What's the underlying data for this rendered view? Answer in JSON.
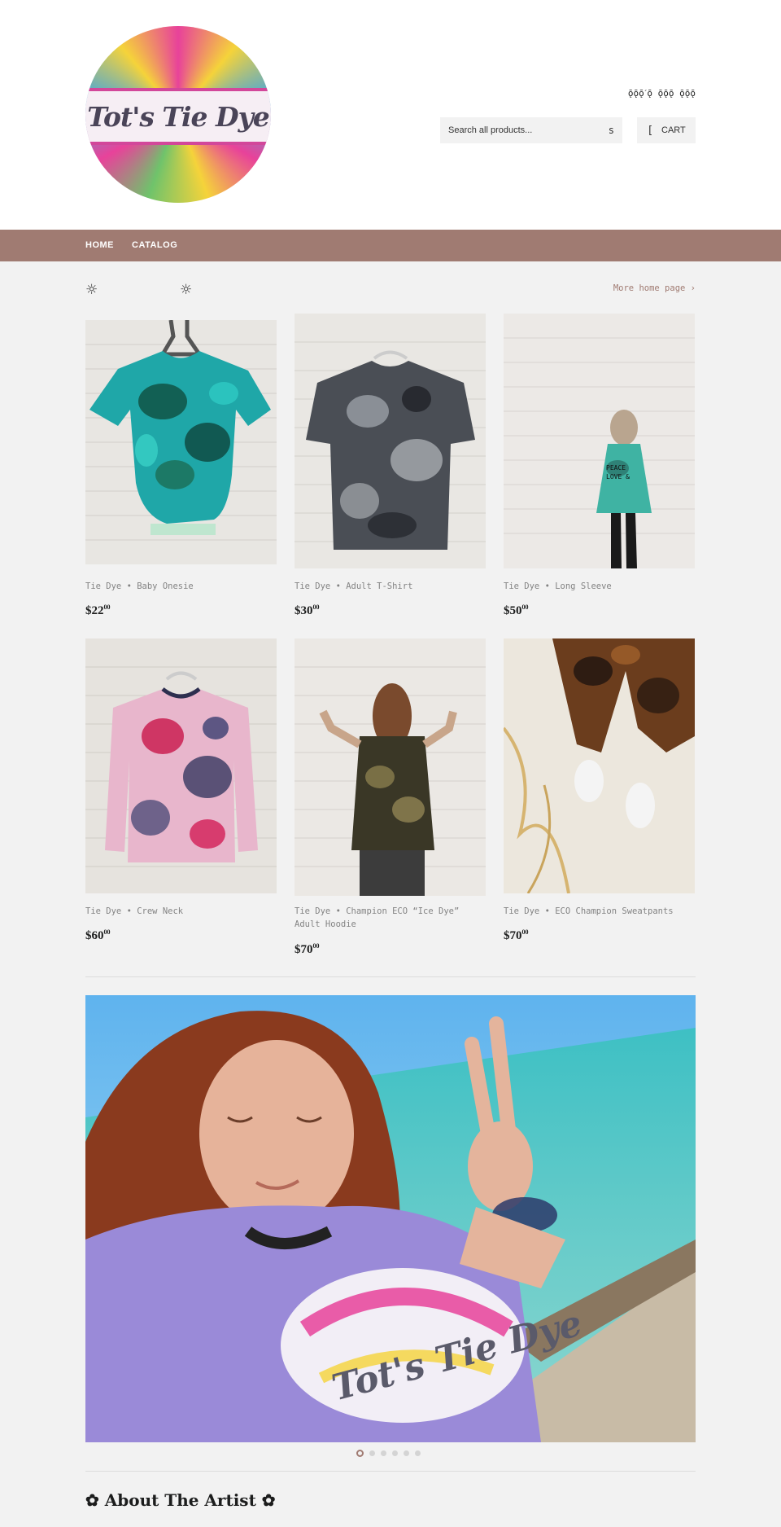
{
  "brand": {
    "logo_text": "Tot's Tie Dye",
    "accent_color": "#a07b72"
  },
  "header": {
    "links_text": "ǭǭǭˊǭ ǭǭǭ ǭǭǭ",
    "search_placeholder": "Search all products...",
    "search_icon": "s",
    "cart_icon": "[",
    "cart_label": "CART"
  },
  "nav": {
    "items": [
      "HOME",
      "CATALOG"
    ]
  },
  "featured": {
    "sun_left": "☼",
    "sun_right": "☼",
    "more_link": "More home page ›",
    "products": [
      {
        "title": "Tie Dye • Baby Onesie",
        "price_main": "$22",
        "price_cents": "00",
        "image": "teal-onesie"
      },
      {
        "title": "Tie Dye • Adult T-Shirt",
        "price_main": "$30",
        "price_cents": "00",
        "image": "gray-tshirt"
      },
      {
        "title": "Tie Dye • Long Sleeve",
        "price_main": "$50",
        "price_cents": "00",
        "image": "long-sleeve"
      },
      {
        "title": "Tie Dye • Crew Neck",
        "price_main": "$60",
        "price_cents": "00",
        "image": "crew-neck"
      },
      {
        "title": "Tie Dye • Champion ECO “Ice Dye” Adult Hoodie",
        "price_main": "$70",
        "price_cents": "00",
        "image": "hoodie"
      },
      {
        "title": "Tie Dye • ECO Champion Sweatpants",
        "price_main": "$70",
        "price_cents": "00",
        "image": "sweatpants"
      }
    ]
  },
  "slideshow": {
    "dot_count": 6,
    "active_index": 0,
    "shirt_text": "Tot's Tie Dye"
  },
  "about": {
    "title": "✿ About The Artist ✿"
  }
}
